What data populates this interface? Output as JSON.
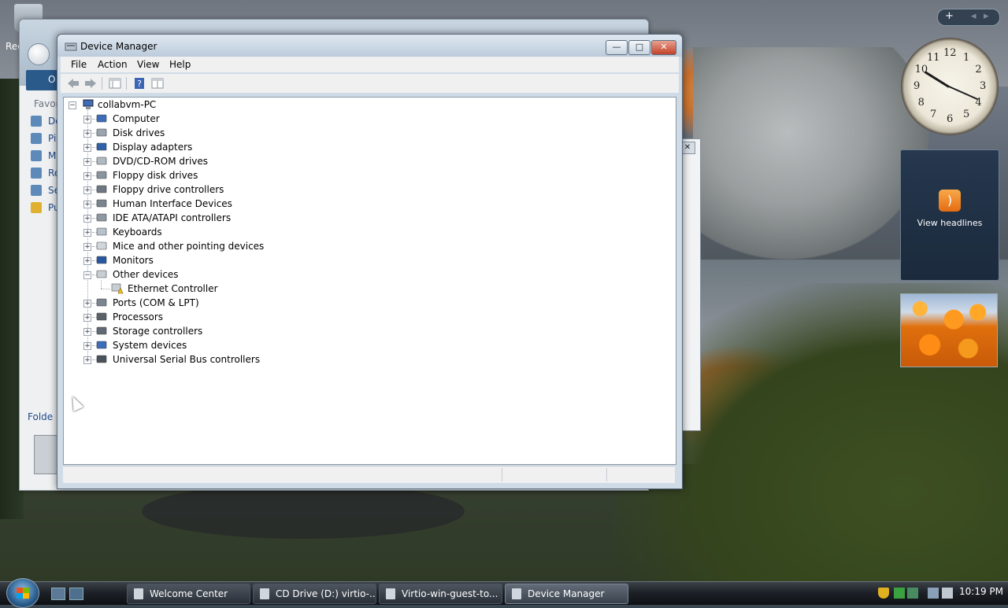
{
  "desktop": {
    "recycle_label": "Rec",
    "bg_window": {
      "bar_label": "O",
      "favorites_label": "Favor",
      "side_items": [
        "De",
        "Pi",
        "M",
        "Re",
        "Se",
        "Pu"
      ],
      "folders_label": "Folde"
    },
    "clock": {
      "numbers": [
        "12",
        "1",
        "2",
        "3",
        "4",
        "5",
        "6",
        "7",
        "8",
        "9",
        "10",
        "11"
      ]
    },
    "news_gadget": {
      "label": "View headlines"
    },
    "sidebar_controls": {
      "add": "+",
      "prev": "◂",
      "next": "▸"
    }
  },
  "window": {
    "title": "Device Manager",
    "buttons": {
      "minimize": "—",
      "maximize": "□",
      "close": "✕"
    },
    "menu": [
      "File",
      "Action",
      "View",
      "Help"
    ],
    "tree": {
      "root": "collabvm-PC",
      "items": [
        {
          "label": "Computer",
          "icon": "computer-icon",
          "expanded": false
        },
        {
          "label": "Disk drives",
          "icon": "disk-drive-icon",
          "expanded": false
        },
        {
          "label": "Display adapters",
          "icon": "display-adapter-icon",
          "expanded": false
        },
        {
          "label": "DVD/CD-ROM drives",
          "icon": "dvd-drive-icon",
          "expanded": false
        },
        {
          "label": "Floppy disk drives",
          "icon": "floppy-drive-icon",
          "expanded": false
        },
        {
          "label": "Floppy drive controllers",
          "icon": "floppy-controller-icon",
          "expanded": false
        },
        {
          "label": "Human Interface Devices",
          "icon": "hid-icon",
          "expanded": false
        },
        {
          "label": "IDE ATA/ATAPI controllers",
          "icon": "ide-controller-icon",
          "expanded": false
        },
        {
          "label": "Keyboards",
          "icon": "keyboard-icon",
          "expanded": false
        },
        {
          "label": "Mice and other pointing devices",
          "icon": "mouse-icon",
          "expanded": false
        },
        {
          "label": "Monitors",
          "icon": "monitor-icon",
          "expanded": false
        },
        {
          "label": "Other devices",
          "icon": "unknown-device-icon",
          "expanded": true,
          "children": [
            {
              "label": "Ethernet Controller",
              "icon": "warning-device-icon"
            }
          ]
        },
        {
          "label": "Ports (COM & LPT)",
          "icon": "port-icon",
          "expanded": false
        },
        {
          "label": "Processors",
          "icon": "processor-icon",
          "expanded": false
        },
        {
          "label": "Storage controllers",
          "icon": "storage-controller-icon",
          "expanded": false
        },
        {
          "label": "System devices",
          "icon": "system-device-icon",
          "expanded": false
        },
        {
          "label": "Universal Serial Bus controllers",
          "icon": "usb-icon",
          "expanded": false
        }
      ]
    }
  },
  "taskbar": {
    "tasks": [
      {
        "label": "Welcome Center",
        "active": false
      },
      {
        "label": "CD Drive (D:) virtio-...",
        "active": false
      },
      {
        "label": "Virtio-win-guest-to...",
        "active": false
      },
      {
        "label": "Device Manager",
        "active": true
      }
    ],
    "time": "10:19 PM"
  },
  "colors": {
    "accent": "#2a5a8a",
    "close_red": "#c2432a",
    "warning": "#f2c21a"
  }
}
